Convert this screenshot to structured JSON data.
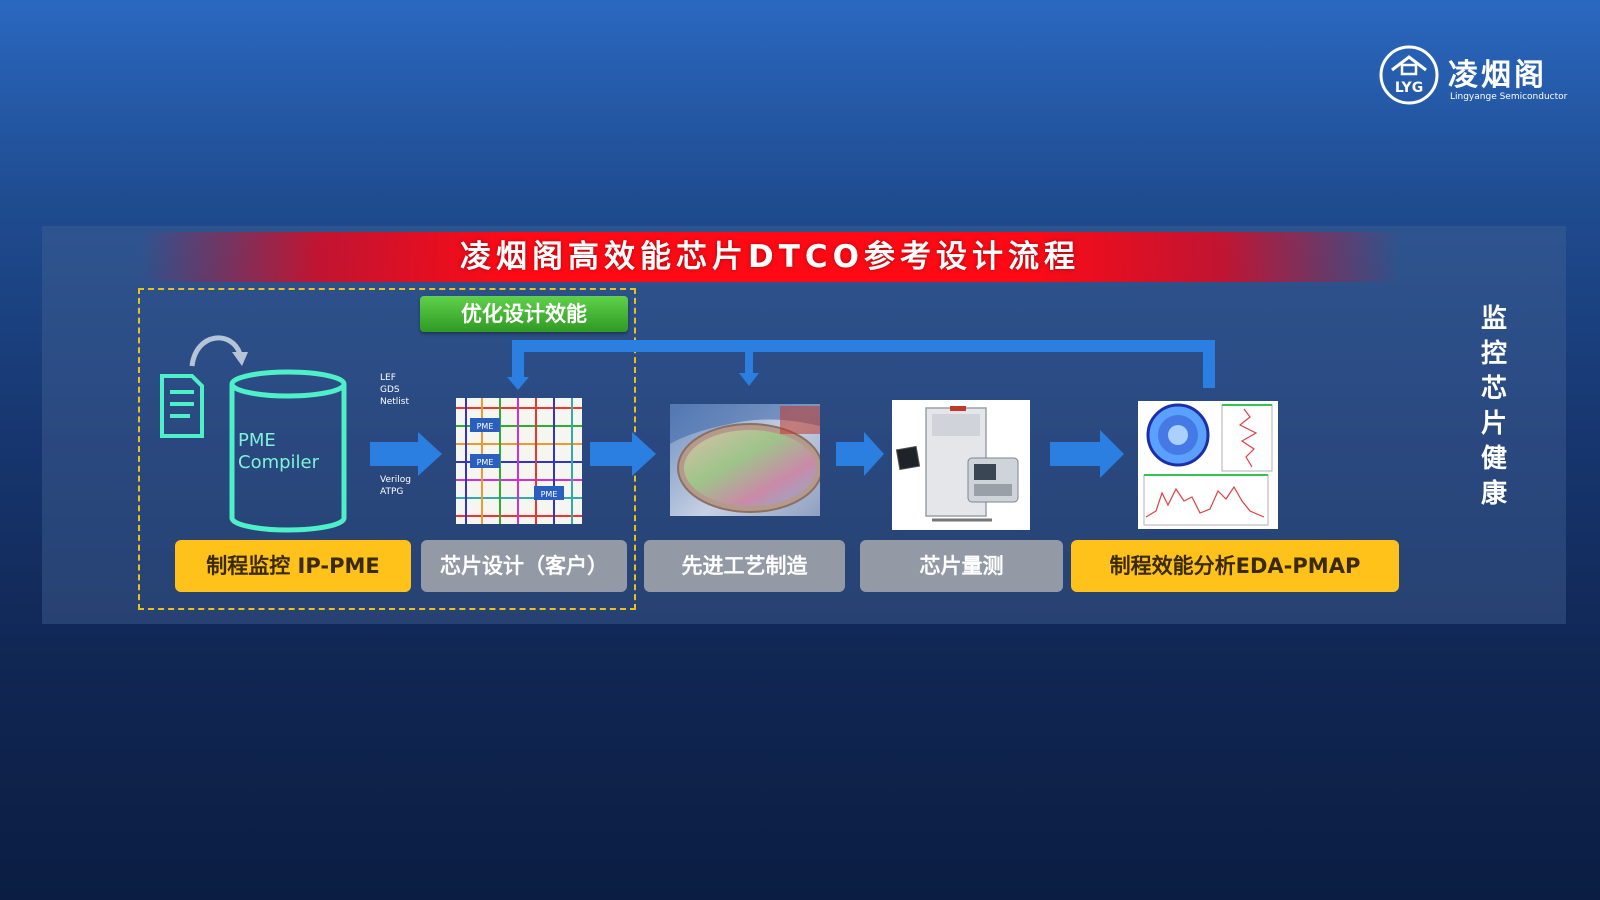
{
  "logo": {
    "emblem_text": "LYG",
    "name_cn": "凌烟阁",
    "name_en": "Lingyange Semiconductor"
  },
  "banner": {
    "title": "凌烟阁高效能芯片DTCO参考设计流程"
  },
  "optimize_label": "优化设计效能",
  "side_label": [
    "监",
    "控",
    "芯",
    "片",
    "健",
    "康"
  ],
  "compiler": {
    "line1": "PME",
    "line2": "Compiler"
  },
  "io_labels": {
    "top": [
      "LEF",
      "GDS",
      "Netlist"
    ],
    "bottom": [
      "Verilog",
      "ATPG"
    ]
  },
  "chip_tags": [
    "PME",
    "PME",
    "PME"
  ],
  "steps": [
    {
      "label": "制程监控 IP-PME",
      "style": "yellow"
    },
    {
      "label": "芯片设计（客户）",
      "style": "gray"
    },
    {
      "label": "先进工艺制造",
      "style": "gray"
    },
    {
      "label": "芯片量测",
      "style": "gray"
    },
    {
      "label": "制程效能分析EDA-PMAP",
      "style": "yellow"
    }
  ],
  "colors": {
    "arrow": "#2a7fe0",
    "banner_red": "#ff0a14",
    "highlight_yellow": "#ffc21a",
    "teal": "#4ff0c8",
    "green_button": "#3aa52a"
  },
  "icons": [
    "document-icon",
    "database-cylinder-icon",
    "cycle-arrow-icon",
    "right-arrow-icon",
    "feedback-bracket-arrow-icon"
  ]
}
